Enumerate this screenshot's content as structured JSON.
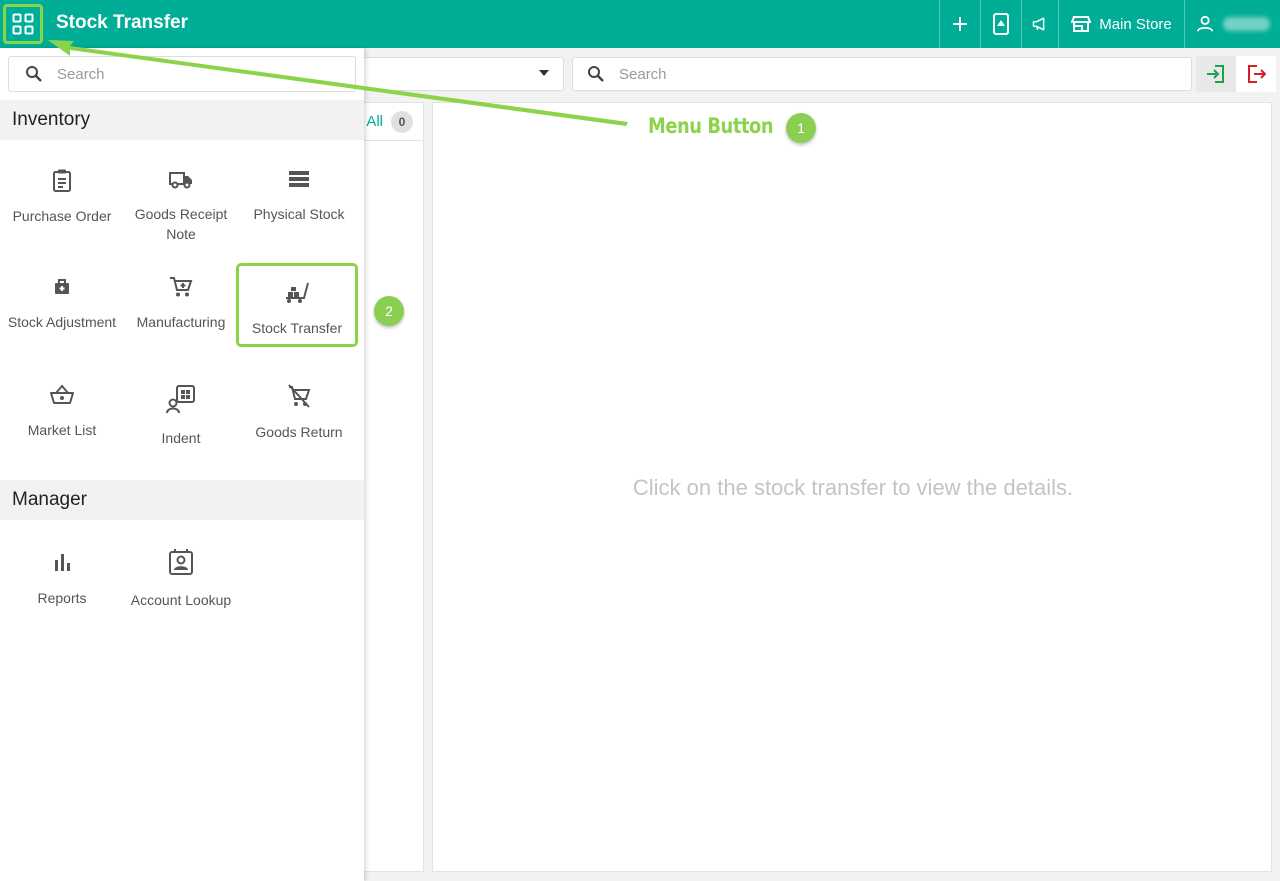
{
  "header": {
    "title": "Stock Transfer",
    "store_label": "Main Store"
  },
  "filter": {
    "search_placeholder": "Search"
  },
  "list": {
    "all_label": "All",
    "count": "0"
  },
  "detail": {
    "empty_message": "Click on the stock transfer to view the details."
  },
  "drawer": {
    "search_placeholder": "Search",
    "sections": [
      {
        "title": "Inventory",
        "items": [
          {
            "label": "Purchase Order",
            "icon": "clipboard-icon"
          },
          {
            "label": "Goods Receipt Note",
            "icon": "truck-icon"
          },
          {
            "label": "Physical Stock",
            "icon": "storage-icon"
          },
          {
            "label": "Stock Adjustment",
            "icon": "medical-bag-icon"
          },
          {
            "label": "Manufacturing",
            "icon": "cart-icon"
          },
          {
            "label": "Stock Transfer",
            "icon": "trolley-icon"
          },
          {
            "label": "Market List",
            "icon": "basket-icon"
          },
          {
            "label": "Indent",
            "icon": "indent-icon"
          },
          {
            "label": "Goods Return",
            "icon": "cart-off-icon"
          }
        ]
      },
      {
        "title": "Manager",
        "items": [
          {
            "label": "Reports",
            "icon": "bar-chart-icon"
          },
          {
            "label": "Account Lookup",
            "icon": "contact-card-icon"
          }
        ]
      }
    ]
  },
  "annotations": {
    "menu_label": "Menu Button",
    "badge_1": "1",
    "badge_2": "2",
    "color": "#8bd44a"
  },
  "colors": {
    "primary": "#00ad96",
    "login_icon": "#1aa34a",
    "logout_icon": "#d0202a"
  }
}
